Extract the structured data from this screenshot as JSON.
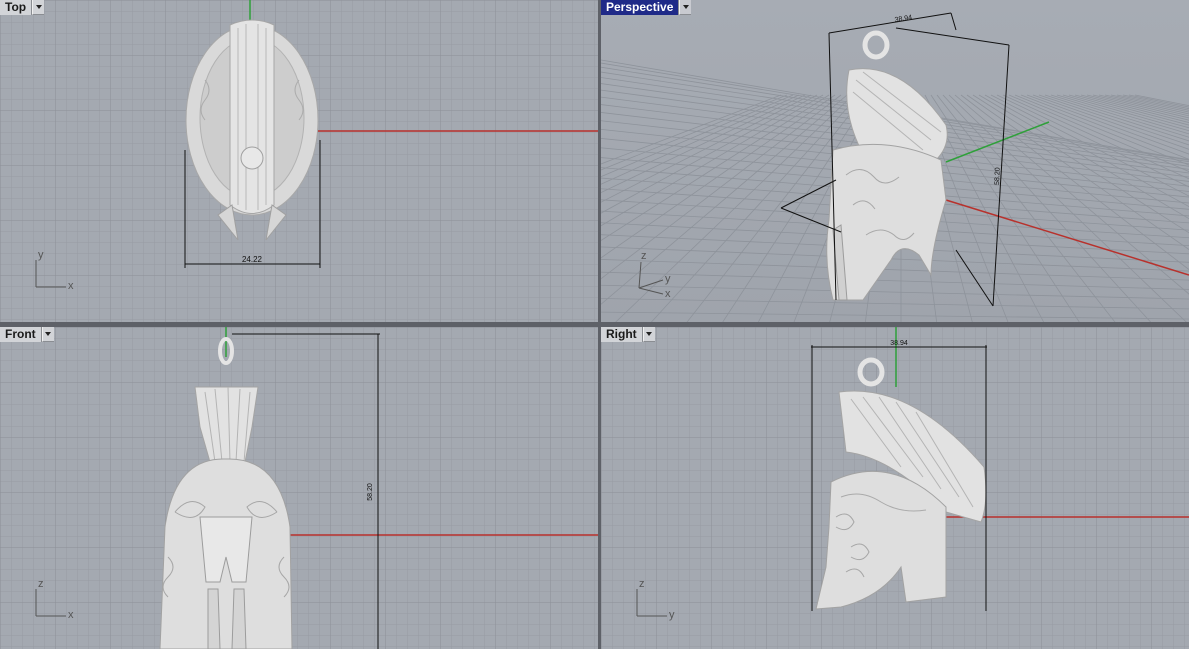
{
  "viewports": {
    "top": {
      "label": "Top",
      "axis_h": "x",
      "axis_v": "y",
      "dimension": "24.22"
    },
    "perspective": {
      "label": "Perspective",
      "axis_h": "x",
      "axis_v": "z",
      "axis_3": "y",
      "dim_width": "38.94",
      "dim_height": "58.20"
    },
    "front": {
      "label": "Front",
      "axis_h": "x",
      "axis_v": "z",
      "dimension": "58.20"
    },
    "right": {
      "label": "Right",
      "axis_h": "y",
      "axis_v": "z",
      "dimension": "38.94"
    }
  },
  "colors": {
    "background": "#a4a9b1",
    "grid_minor": "#989da5",
    "grid_major": "#8d9199",
    "x_axis": "#b8312c",
    "y_axis": "#2fa03a",
    "active_label": "#1f2a88",
    "model": "#dfdfdf"
  }
}
